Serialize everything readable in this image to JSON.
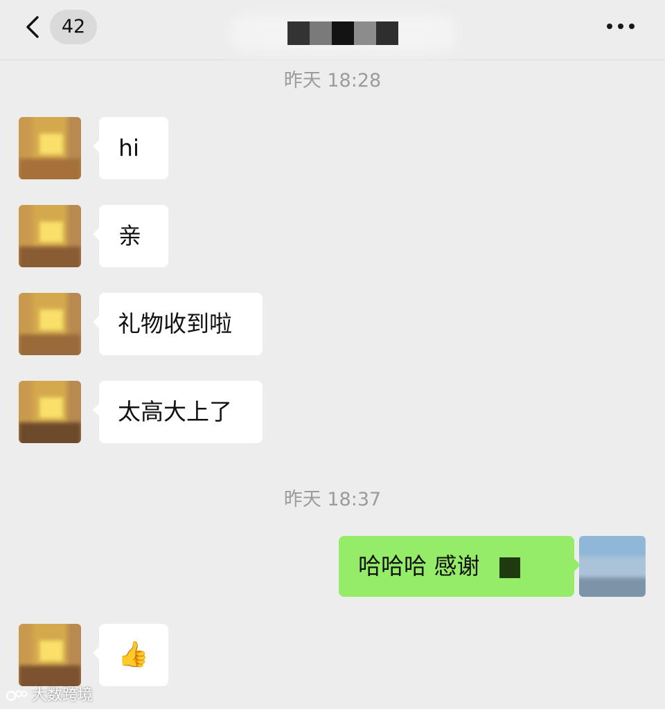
{
  "header": {
    "unread_count": "42",
    "contact_name": "██████",
    "back_icon": "chevron-left-icon",
    "more_icon": "ellipsis-icon"
  },
  "timestamps": [
    "昨天 18:28",
    "昨天 18:37"
  ],
  "messages": [
    {
      "direction": "incoming",
      "text": "hi"
    },
    {
      "direction": "incoming",
      "text": "亲"
    },
    {
      "direction": "incoming",
      "text": "礼物收到啦"
    },
    {
      "direction": "incoming",
      "text": "太高大上了"
    },
    {
      "direction": "outgoing",
      "text": "哈哈哈 感谢"
    },
    {
      "direction": "incoming",
      "text": "👍"
    }
  ],
  "colors": {
    "background": "#ededed",
    "incoming_bubble": "#ffffff",
    "outgoing_bubble": "#95ec69",
    "timestamp_text": "#9b9b9b"
  },
  "watermark": {
    "text": "大数跨境",
    "icon": "logo-icon"
  }
}
